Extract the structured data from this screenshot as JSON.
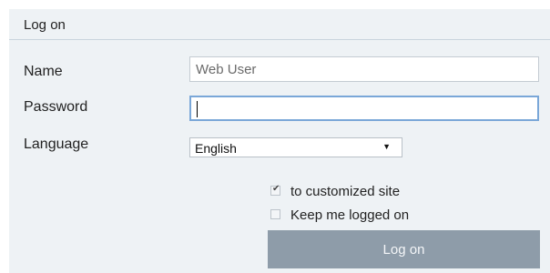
{
  "header": {
    "title": "Log on"
  },
  "form": {
    "name_label": "Name",
    "name_value": "Web User",
    "password_label": "Password",
    "password_value": "",
    "language_label": "Language",
    "language_selected": "English",
    "language_arrow": "▼"
  },
  "options": {
    "customized_site": {
      "label": "to customized site",
      "checked": true
    },
    "keep_logged_on": {
      "label": "Keep me logged on",
      "checked": false
    },
    "check_glyph": "✔"
  },
  "actions": {
    "logon_label": "Log on"
  },
  "colors": {
    "panel_bg": "#eef2f5",
    "button_bg": "#8e9ca9",
    "focus_border": "#7aa7d8"
  }
}
